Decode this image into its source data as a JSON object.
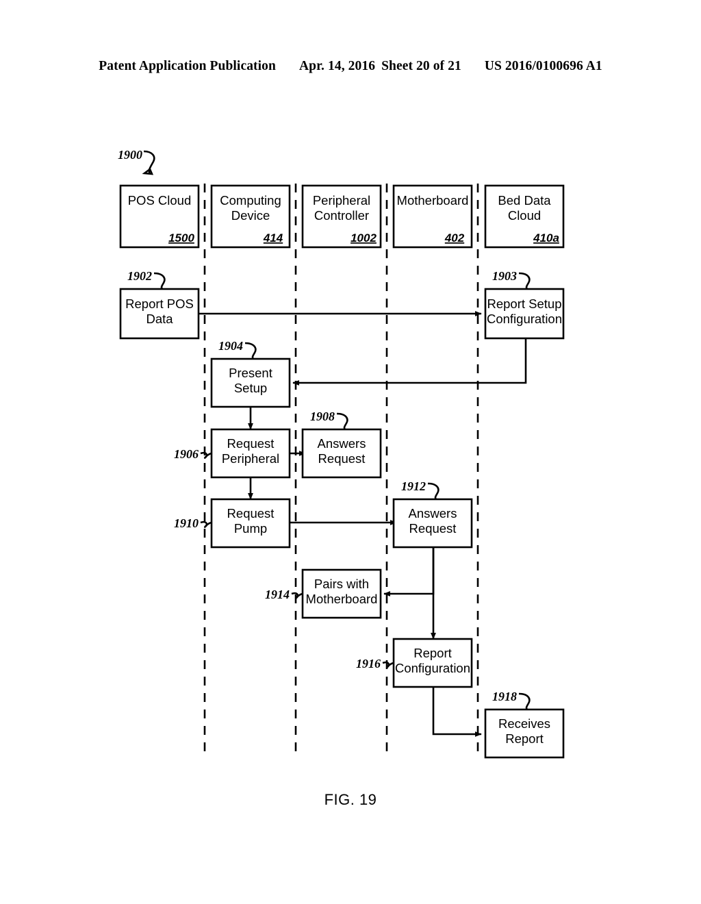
{
  "header": {
    "publication": "Patent Application Publication",
    "date": "Apr. 14, 2016",
    "sheet": "Sheet 20 of 21",
    "docnum": "US 2016/0100696 A1"
  },
  "figure": {
    "caption": "FIG. 19",
    "diagram_callout": "1900"
  },
  "lanes": [
    {
      "title_line1": "POS Cloud",
      "title_line2": "",
      "ref": "1500"
    },
    {
      "title_line1": "Computing",
      "title_line2": "Device",
      "ref": "414"
    },
    {
      "title_line1": "Peripheral",
      "title_line2": "Controller",
      "ref": "1002"
    },
    {
      "title_line1": "Motherboard",
      "title_line2": "",
      "ref": "402"
    },
    {
      "title_line1": "Bed Data",
      "title_line2": "Cloud",
      "ref": "410a"
    }
  ],
  "steps": [
    {
      "id": "1902",
      "callout": "1902",
      "line1": "Report POS",
      "line2": "Data",
      "lane": 0
    },
    {
      "id": "1903",
      "callout": "1903",
      "line1": "Report Setup",
      "line2": "Configuration",
      "lane": 4
    },
    {
      "id": "1904",
      "callout": "1904",
      "line1": "Present",
      "line2": "Setup",
      "lane": 1
    },
    {
      "id": "1906",
      "callout": "1906",
      "line1": "Request",
      "line2": "Peripheral",
      "lane": 1
    },
    {
      "id": "1908",
      "callout": "1908",
      "line1": "Answers",
      "line2": "Request",
      "lane": 2
    },
    {
      "id": "1910",
      "callout": "1910",
      "line1": "Request",
      "line2": "Pump",
      "lane": 1
    },
    {
      "id": "1912",
      "callout": "1912",
      "line1": "Answers",
      "line2": "Request",
      "lane": 3
    },
    {
      "id": "1914",
      "callout": "1914",
      "line1": "Pairs with",
      "line2": "Motherboard",
      "lane": 2
    },
    {
      "id": "1916",
      "callout": "1916",
      "line1": "Report",
      "line2": "Configuration",
      "lane": 3
    },
    {
      "id": "1918",
      "callout": "1918",
      "line1": "Receives",
      "line2": "Report",
      "lane": 4
    }
  ],
  "colors": {
    "ink": "#000000",
    "paper": "#ffffff"
  }
}
